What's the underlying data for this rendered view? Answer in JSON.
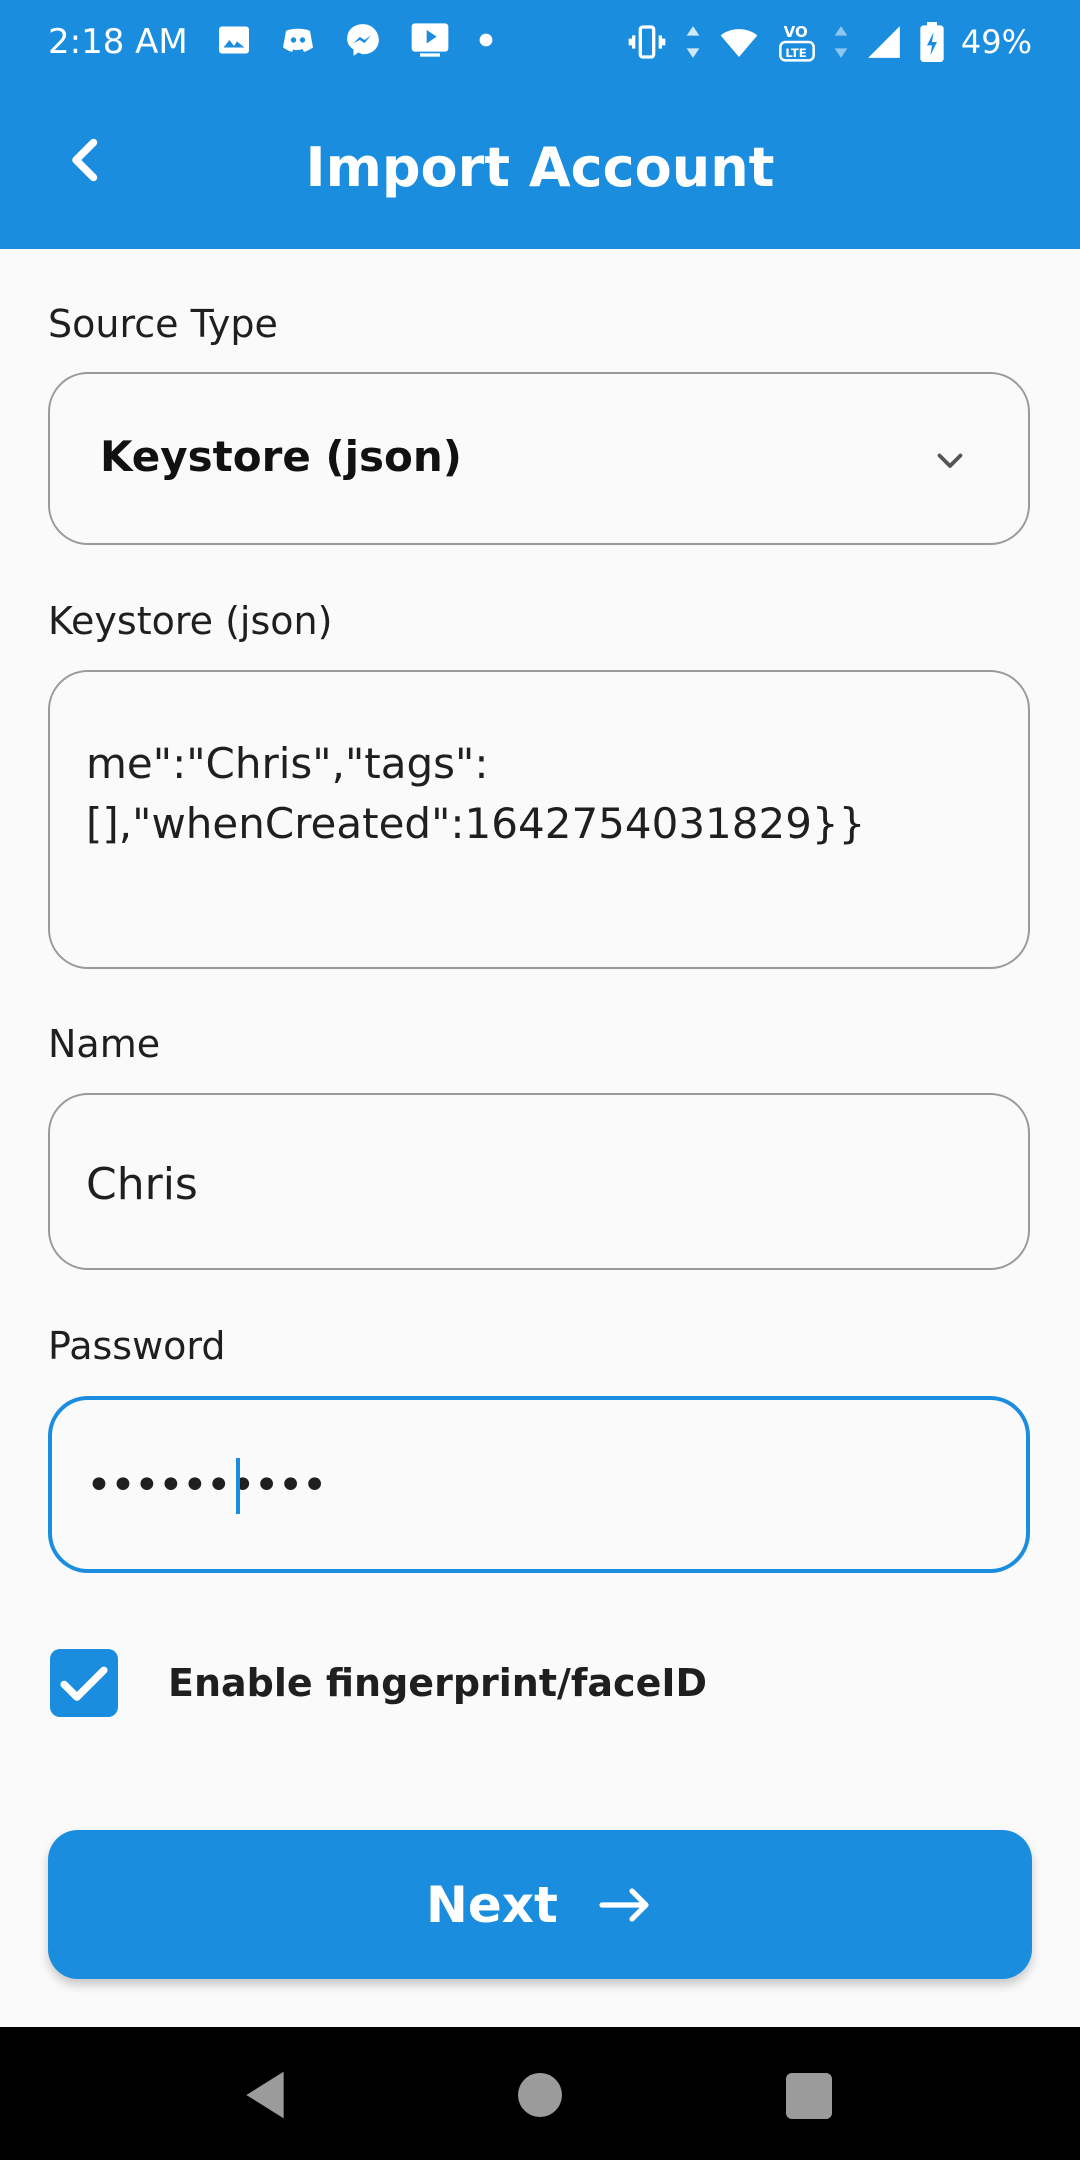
{
  "status_bar": {
    "time": "2:18 AM",
    "battery": "49%",
    "icons": [
      "image-icon",
      "discord-icon",
      "messenger-icon",
      "play-icon",
      "dot-icon",
      "vibrate-icon",
      "wifi-icon",
      "volte-icon",
      "signal-icon",
      "battery-icon"
    ]
  },
  "app_bar": {
    "title": "Import Account",
    "back_icon": "chevron-left-icon"
  },
  "form": {
    "source_type_label": "Source Type",
    "source_type_value": "Keystore (json)",
    "keystore_label": "Keystore (json)",
    "keystore_value": "me\":\"Chris\",\"tags\":\n[],\"whenCreated\":1642754031829}}",
    "name_label": "Name",
    "name_value": "Chris",
    "password_label": "Password",
    "password_value": "••••••••••",
    "checkbox_label": "Enable fingerprint/faceID",
    "checkbox_checked": true
  },
  "actions": {
    "next_label": "Next"
  },
  "colors": {
    "primary": "#1a8ddf",
    "background": "#fafafa",
    "nav_bar": "#000000"
  }
}
